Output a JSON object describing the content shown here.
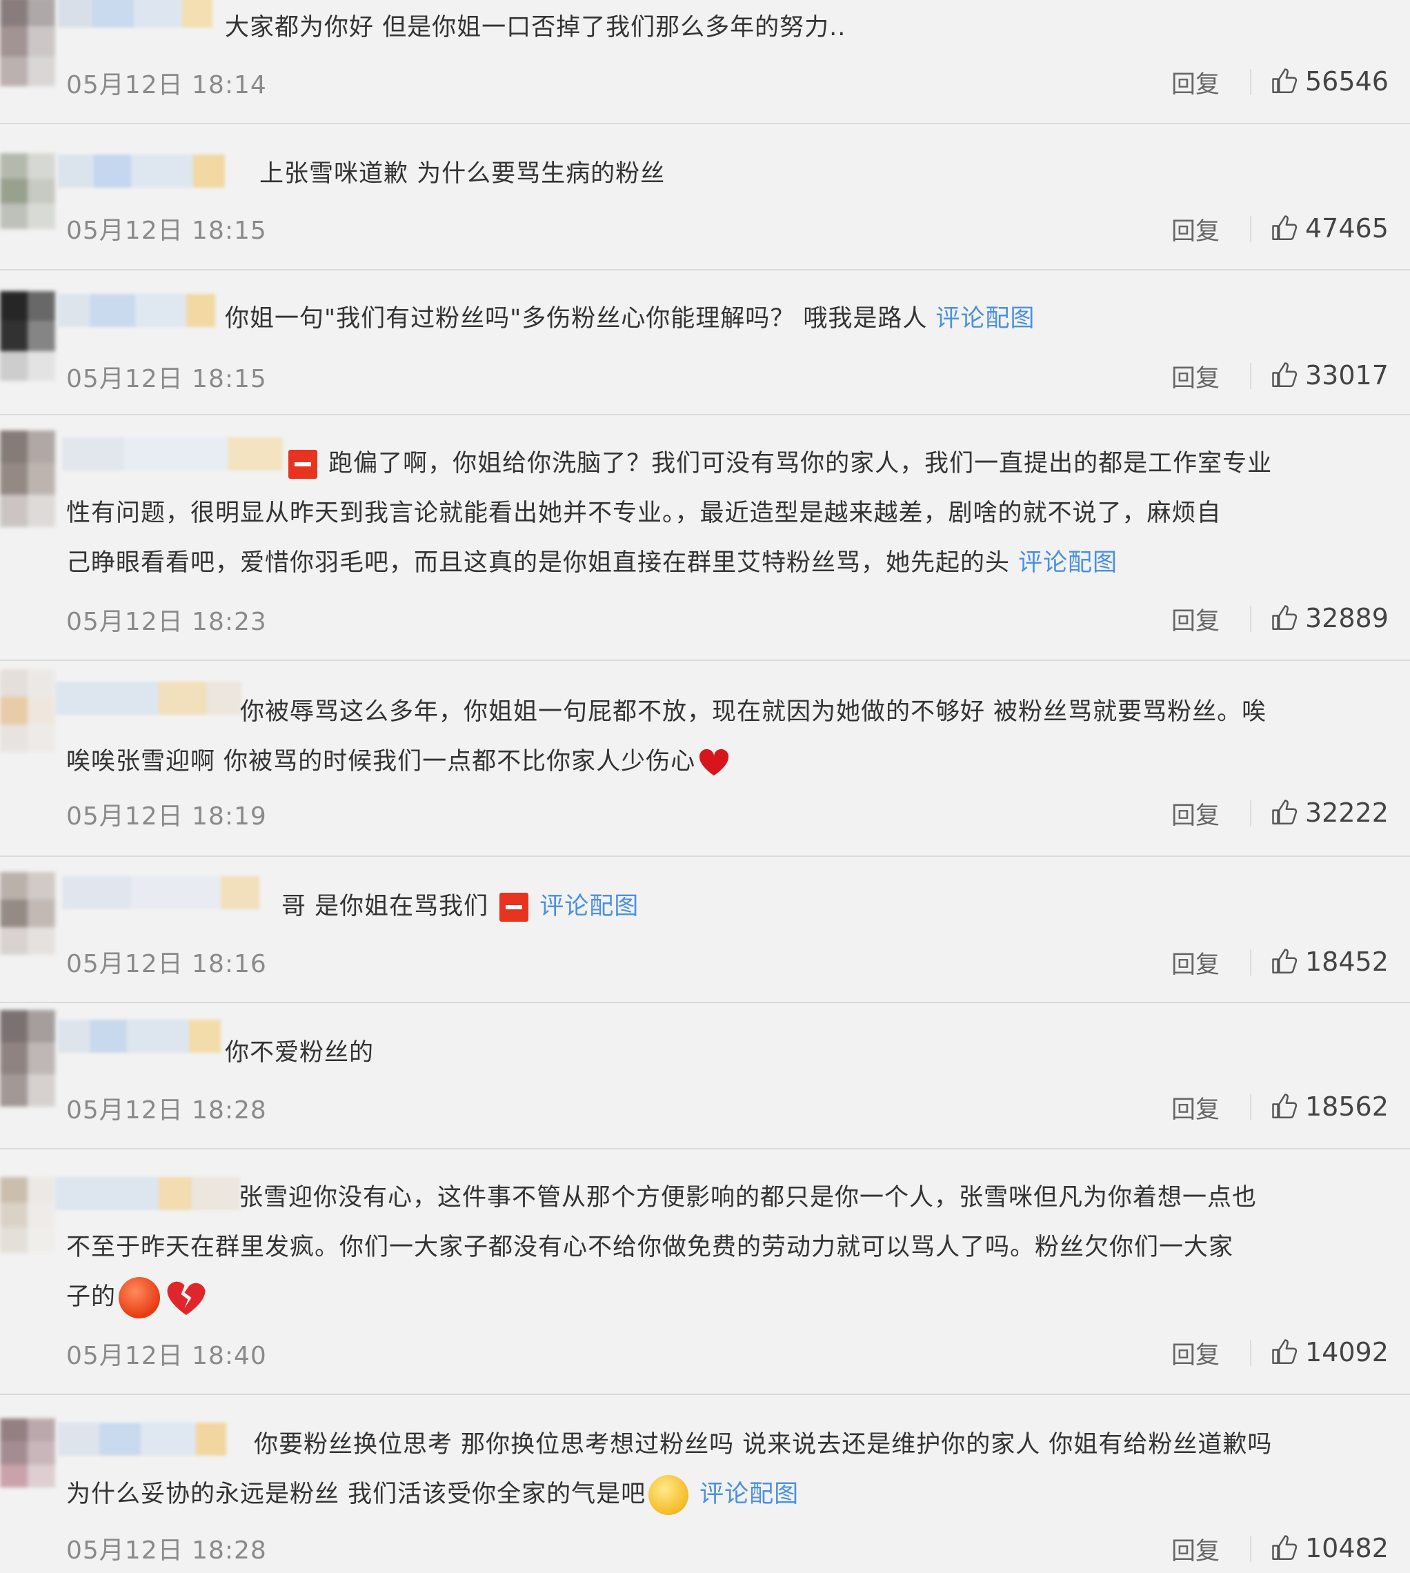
{
  "colors": {
    "background": "#f2f2f2",
    "link": "#4a90e2",
    "divider": "#dadada"
  },
  "labels": {
    "reply": "回复",
    "pic_link": "评论配图"
  },
  "comments": [
    {
      "lines": [
        "大家都为你好 但是你姐一口否掉了我们那么多年的努力.."
      ],
      "date": "05月12日 18:14",
      "likes": "56546"
    },
    {
      "lines": [
        "上张雪咪道歉 为什么要骂生病的粉丝"
      ],
      "date": "05月12日 18:15",
      "likes": "47465"
    },
    {
      "lines": [
        "你姐一句\"我们有过粉丝吗\"多伤粉丝心你能理解吗？ 哦我是路人"
      ],
      "date": "05月12日 18:15",
      "likes": "33017"
    },
    {
      "lines": [
        "跑偏了啊，你姐给你洗脑了？我们可没有骂你的家人，我们一直提出的都是工作室专业",
        "性有问题，很明显从昨天到我言论就能看出她并不专业。，最近造型是越来越差，剧啥的就不说了，麻烦自",
        "己睁眼看看吧，爱惜你羽毛吧，而且这真的是你姐直接在群里艾特粉丝骂，她先起的头"
      ],
      "date": "05月12日 18:23",
      "likes": "32889"
    },
    {
      "lines": [
        "你被辱骂这么多年，你姐姐一句屁都不放，现在就因为她做的不够好 被粉丝骂就要骂粉丝。唉",
        "唉唉张雪迎啊 你被骂的时候我们一点都不比你家人少伤心"
      ],
      "date": "05月12日 18:19",
      "likes": "32222"
    },
    {
      "lines": [
        "哥 是你姐在骂我们"
      ],
      "date": "05月12日 18:16",
      "likes": "18452"
    },
    {
      "lines": [
        "你不爱粉丝的"
      ],
      "date": "05月12日 18:28",
      "likes": "18562"
    },
    {
      "lines": [
        "张雪迎你没有心，这件事不管从那个方便影响的都只是你一个人，张雪咪但凡为你着想一点也",
        "不至于昨天在群里发疯。你们一大家子都没有心不给你做免费的劳动力就可以骂人了吗。粉丝欠你们一大家",
        "子的"
      ],
      "date": "05月12日 18:40",
      "likes": "14092"
    },
    {
      "lines": [
        "你要粉丝换位思考 那你换位思考想过粉丝吗 说来说去还是维护你的家人 你姐有给粉丝道歉吗",
        "为什么妥协的永远是粉丝 我们活该受你全家的气是吧"
      ],
      "date": "05月12日 18:28",
      "likes": "10482"
    }
  ]
}
